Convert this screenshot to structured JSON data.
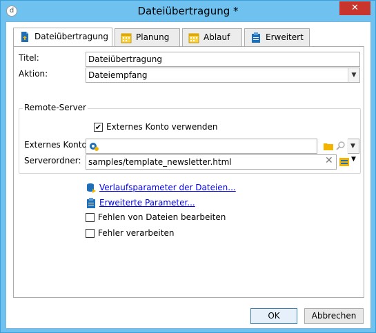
{
  "window": {
    "title": "Dateiübertragung *",
    "close_label": "✕"
  },
  "tabs": [
    {
      "label": "Dateiübertragung",
      "icon": "file-transfer-icon",
      "active": true
    },
    {
      "label": "Planung",
      "icon": "calendar-icon",
      "active": false
    },
    {
      "label": "Ablauf",
      "icon": "calendar-icon",
      "active": false
    },
    {
      "label": "Erweitert",
      "icon": "clipboard-icon",
      "active": false
    }
  ],
  "form": {
    "title_label": "Titel:",
    "title_value": "Dateiübertragung",
    "action_label": "Aktion:",
    "action_value": "Dateiempfang"
  },
  "remote_server": {
    "group_label": "Remote-Server",
    "use_external_account_label": "Externes Konto verwenden",
    "use_external_account_checked": true,
    "external_account_label": "Externes Konto:",
    "external_account_value": "",
    "server_folder_label": "Serverordner:",
    "server_folder_value": "samples/template_newsletter.html"
  },
  "links": {
    "history_params": "Verlaufsparameter der Dateien...",
    "advanced_params": "Erweiterte Parameter..."
  },
  "options": {
    "handle_file_errors_label": "Fehlen von Dateien bearbeiten",
    "handle_file_errors_checked": false,
    "process_errors_label": "Fehler verarbeiten",
    "process_errors_checked": false
  },
  "buttons": {
    "ok": "OK",
    "cancel": "Abbrechen"
  },
  "colors": {
    "window_frame": "#6fc1ef",
    "close_button": "#c7352c",
    "link": "#0000ee",
    "icon_blue": "#1f6fb8",
    "icon_yellow": "#f2b400"
  }
}
